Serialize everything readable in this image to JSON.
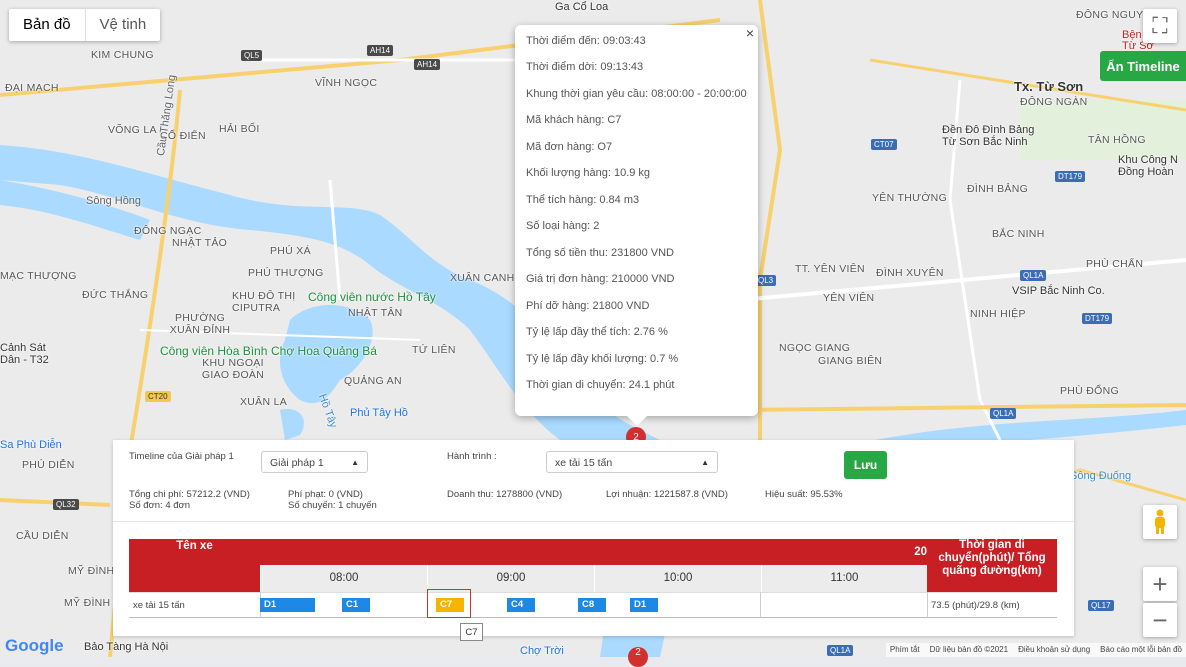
{
  "map_type": {
    "map": "Bản đồ",
    "satellite": "Vệ tinh"
  },
  "timeline_toggle": "Ẩn Timeline",
  "controls": {
    "fullscreen": "⛶",
    "zoom_in": "+",
    "zoom_out": "−"
  },
  "map_labels": {
    "ga_co_loa": "Ga Cổ Loa",
    "dong_nguyen": "ĐÔNG NGUYÊN",
    "kim_chung": "KIM CHUNG",
    "vinh_ngoc": "VĨNH NGỌC",
    "hai_boi": "HẢI BỐI",
    "dai_mach": "ĐẠI MẠCH",
    "vong_la": "VÕNG LA",
    "co_dien": "CỔ ĐIỂN",
    "song_hong": "Sông Hồng",
    "dong_ngac": "ĐÔNG NGẠC",
    "nhat_tao": "NHẬT TẢO",
    "phu_xa": "PHÚ XÁ",
    "mac_thuong": "MẠC THƯỢNG",
    "phu_thuong": "PHÚ THƯỢNG",
    "duc_thang": "ĐỨC THẮNG",
    "khu_do_thi_ciputra": "KHU ĐÔ THỊ CIPUTRA",
    "cong_vien_nuoc": "Công viên nước Hồ Tây",
    "nhat_tan": "NHẬT TÂN",
    "phuong_xuan_dinh": "PHƯỜNG XUÂN ĐỈNH",
    "canh_sat": "Cảnh Sát Dân - T32",
    "cong_vien_hoa_binh": "Công viên Hòa Bình",
    "cho_hoa": "Chợ Hoa Quảng Bá",
    "tu_lien": "TỨ LIÊN",
    "khu_ngoai_giao": "KHU NGOẠI GIAO ĐOÀN",
    "quang_an": "QUẢNG AN",
    "xuan_la": "XUÂN LA",
    "phu_tay_ho": "Phủ Tây Hồ",
    "sa_phu_dien": "Sa Phù Diễn",
    "phu_dien": "PHÚ DIỄN",
    "cau_dien": "CẦU DIỄN",
    "my_dinh": "MỸ ĐÌNH",
    "my_dinh_ii": "MỸ ĐÌNH II",
    "bao_tang": "Bảo Tàng Hà Nội",
    "cho_troi": "Chợ Trời",
    "xuan_canh": "XUÂN CANH",
    "tx_tu_son": "Tx. Từ Sơn",
    "dong_ngan": "ĐÔNG NGÀN",
    "den_do": "Đền Đô Đình Bảng Từ Sơn Bắc Ninh",
    "tan_hong": "TÂN HỒNG",
    "khu_cong_nghiep": "Khu Công N Đồng Hoàn",
    "dinh_bang": "ĐÌNH BẢNG",
    "yen_thuong": "YÊN THƯỜNG",
    "bac_ninh": "BẮC NINH",
    "tt_yen_vien": "TT. YÊN VIÊN",
    "dinh_xuyen": "ĐÌNH XUYÊN",
    "phu_chan": "PHÙ CHẨN",
    "yen_vien": "YÊN VIÊN",
    "vsip": "VSIP Bắc Ninh Co.",
    "ninh_hiep": "NINH HIỆP",
    "giang_bien": "GIANG BIÊN",
    "ngoc_giang": "NGỌC GIANG",
    "phu_dong": "PHÙ ĐỔNG",
    "benh_vien": "Bện thị xã Từ Sơ",
    "ho_tay": "Hồ Tây",
    "song_duong": "Sông Đuống",
    "cau_thang_long": "Cầu Thăng Long"
  },
  "popup": {
    "rows": [
      "Thời điểm đến: 09:03:43",
      "Thời điểm dời: 09:13:43",
      "Khung thời gian yêu cầu: 08:00:00 - 20:00:00",
      "Mã khách hàng: C7",
      "Mã đơn hàng: O7",
      "Khối lượng hàng: 10.9 kg",
      "Thể tích hàng: 0.84 m3",
      "Số loại hàng: 2",
      "Tổng số tiền thu: 231800 VND",
      "Giá trị đơn hàng: 210000 VND",
      "Phí dỡ hàng: 21800 VND",
      "Tỷ lệ lấp đầy thể tích: 2.76 %",
      "Tỷ lệ lấp đầy khối lượng: 0.7 %",
      "Thời gian di chuyển: 24.1 phút"
    ],
    "close": "×"
  },
  "panel": {
    "timeline_label": "Timeline của Giải pháp 1",
    "solution_select": "Giải pháp 1",
    "route_label": "Hành trình :",
    "route_select": "xe tải 15 tấn",
    "save": "Lưu",
    "total_cost": "Tổng chi phí: 57212.2 (VND)",
    "orders": "Số đơn: 4 đơn",
    "penalty": "Phí phạt: 0 (VND)",
    "trips": "Số chuyến: 1 chuyến",
    "revenue": "Doanh thu: 1278800 (VND)",
    "profit": "Lợi nhuận: 1221587.8 (VND)",
    "efficiency": "Hiệu suất: 95.53%"
  },
  "timeline": {
    "col_name": "Tên xe",
    "date_header": "20",
    "col_right": "Thời gian di chuyển(phút)/ Tổng quãng đường(km)",
    "hours": [
      "08:00",
      "09:00",
      "10:00",
      "11:00"
    ],
    "vehicle": "xe tải 15 tấn",
    "summary": "73.5 (phút)/29.8 (km)",
    "blocks": [
      "D1",
      "C1",
      "C7",
      "C4",
      "C8",
      "D1"
    ],
    "tooltip": "C7"
  },
  "markers": {
    "m1": "2",
    "m2": "2"
  },
  "footer": [
    "Phím tắt",
    "Dữ liệu bản đồ ©2021",
    "Điều khoản sử dụng",
    "Báo cáo một lỗi bản đồ"
  ],
  "logo": "Google"
}
